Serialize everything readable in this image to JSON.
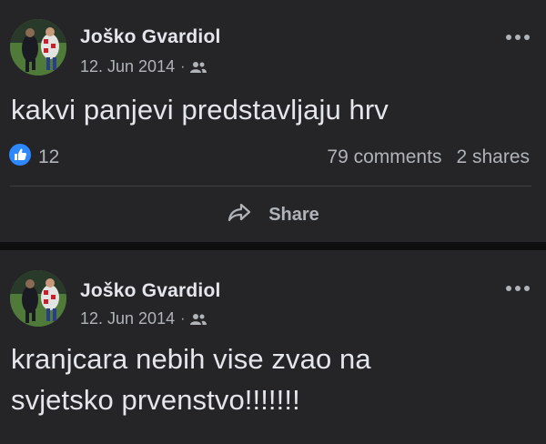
{
  "posts": [
    {
      "author": "Joško Gvardiol",
      "date": "12. Jun 2014",
      "separator": "·",
      "audience_icon": "friends-icon",
      "text": "kakvi panjevi predstavljaju hrv",
      "reactions": {
        "icon": "like-icon",
        "count": "12",
        "comments": "79 comments",
        "shares": "2 shares"
      },
      "share_label": "Share"
    },
    {
      "author": "Joško Gvardiol",
      "date": "12. Jun 2014",
      "separator": "·",
      "audience_icon": "friends-icon",
      "text_lines": [
        "kranjcara nebih vise zvao na",
        "svjetsko prvenstvo!!!!!!!"
      ]
    }
  ],
  "colors": {
    "background": "#0f0f10",
    "card": "#252527",
    "primary_text": "#e4e6eb",
    "secondary_text": "#b0b3b8",
    "like_blue": "#2d88ff"
  }
}
